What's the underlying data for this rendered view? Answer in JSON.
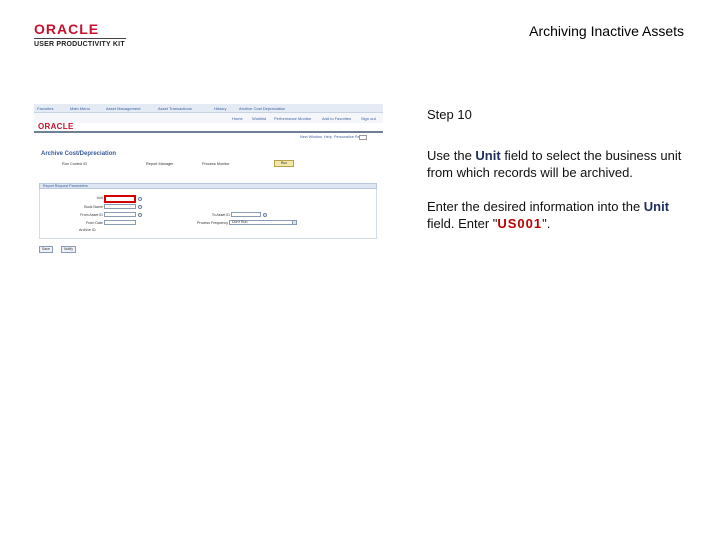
{
  "header": {
    "logo_text": "ORACLE",
    "logo_subtitle": "USER PRODUCTIVITY KIT",
    "title": "Archiving Inactive Assets"
  },
  "screenshot": {
    "breadcrumbs": [
      "Favorites",
      "Main Menu",
      "Asset Management",
      "Asset Transactions",
      "History",
      "Archive Cost Depreciation"
    ],
    "menu_items": [
      "Home",
      "Worklist",
      "Performance Monitor",
      "Add to Favorites",
      "Sign out"
    ],
    "logo_text": "ORACLE",
    "utility_links": [
      "New Window",
      "Help",
      "Personalize Page"
    ],
    "form_title": "Archive Cost/Depreciation",
    "info_labels": [
      "Run Control ID",
      "Report Manager",
      "Process Monitor"
    ],
    "run_button": "Run",
    "section_header": "Report Request Parameters",
    "fields": {
      "unit_label": "Unit",
      "book_label": "Book Name",
      "from_asset_label": "From Asset ID",
      "to_asset_label": "To Asset ID",
      "from_date_label": "From Date",
      "process_frequency_label": "Process Frequency",
      "process_frequency_value": "Don't Run",
      "archive_id_label": "Archive ID"
    },
    "bottom_buttons": [
      "Save",
      "Notify"
    ]
  },
  "instructions": {
    "step": "Step 10",
    "p1_before": "Use the ",
    "p1_field": "Unit",
    "p1_after": " field to select the business unit from which records will be archived.",
    "p2_before": "Enter the desired information into the ",
    "p2_field": "Unit",
    "p2_middle": " field. Enter \"",
    "p2_value": "US001",
    "p2_after": "\"."
  },
  "colors": {
    "oracle_red": "#c8102e",
    "highlight_red": "#d40000",
    "value_red": "#c00000"
  }
}
